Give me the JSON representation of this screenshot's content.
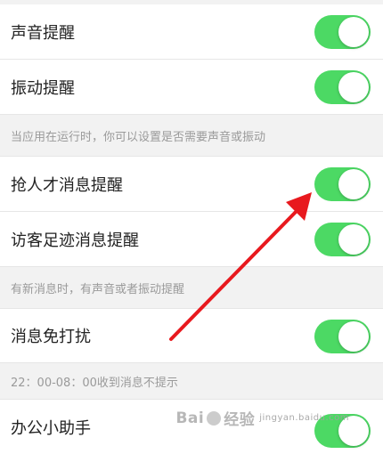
{
  "settings": [
    {
      "label": "声音提醒",
      "on": true
    },
    {
      "label": "振动提醒",
      "on": true
    },
    {
      "label": "抢人才消息提醒",
      "on": true
    },
    {
      "label": "访客足迹消息提醒",
      "on": true
    },
    {
      "label": "消息免打扰",
      "on": true
    },
    {
      "label": "办公小助手",
      "on": true
    }
  ],
  "notes": {
    "vibration": "当应用在运行时，你可以设置是否需要声音或振动",
    "visitor": "有新消息时，有声音或者振动提醒",
    "dnd": "22：00-08：00收到消息不提示"
  },
  "watermark": {
    "brand": "Bai",
    "brand_suffix": "经验",
    "domain": "jingyan.baidu.com"
  },
  "colors": {
    "toggle_on": "#4cd964",
    "arrow": "#e8191e"
  }
}
